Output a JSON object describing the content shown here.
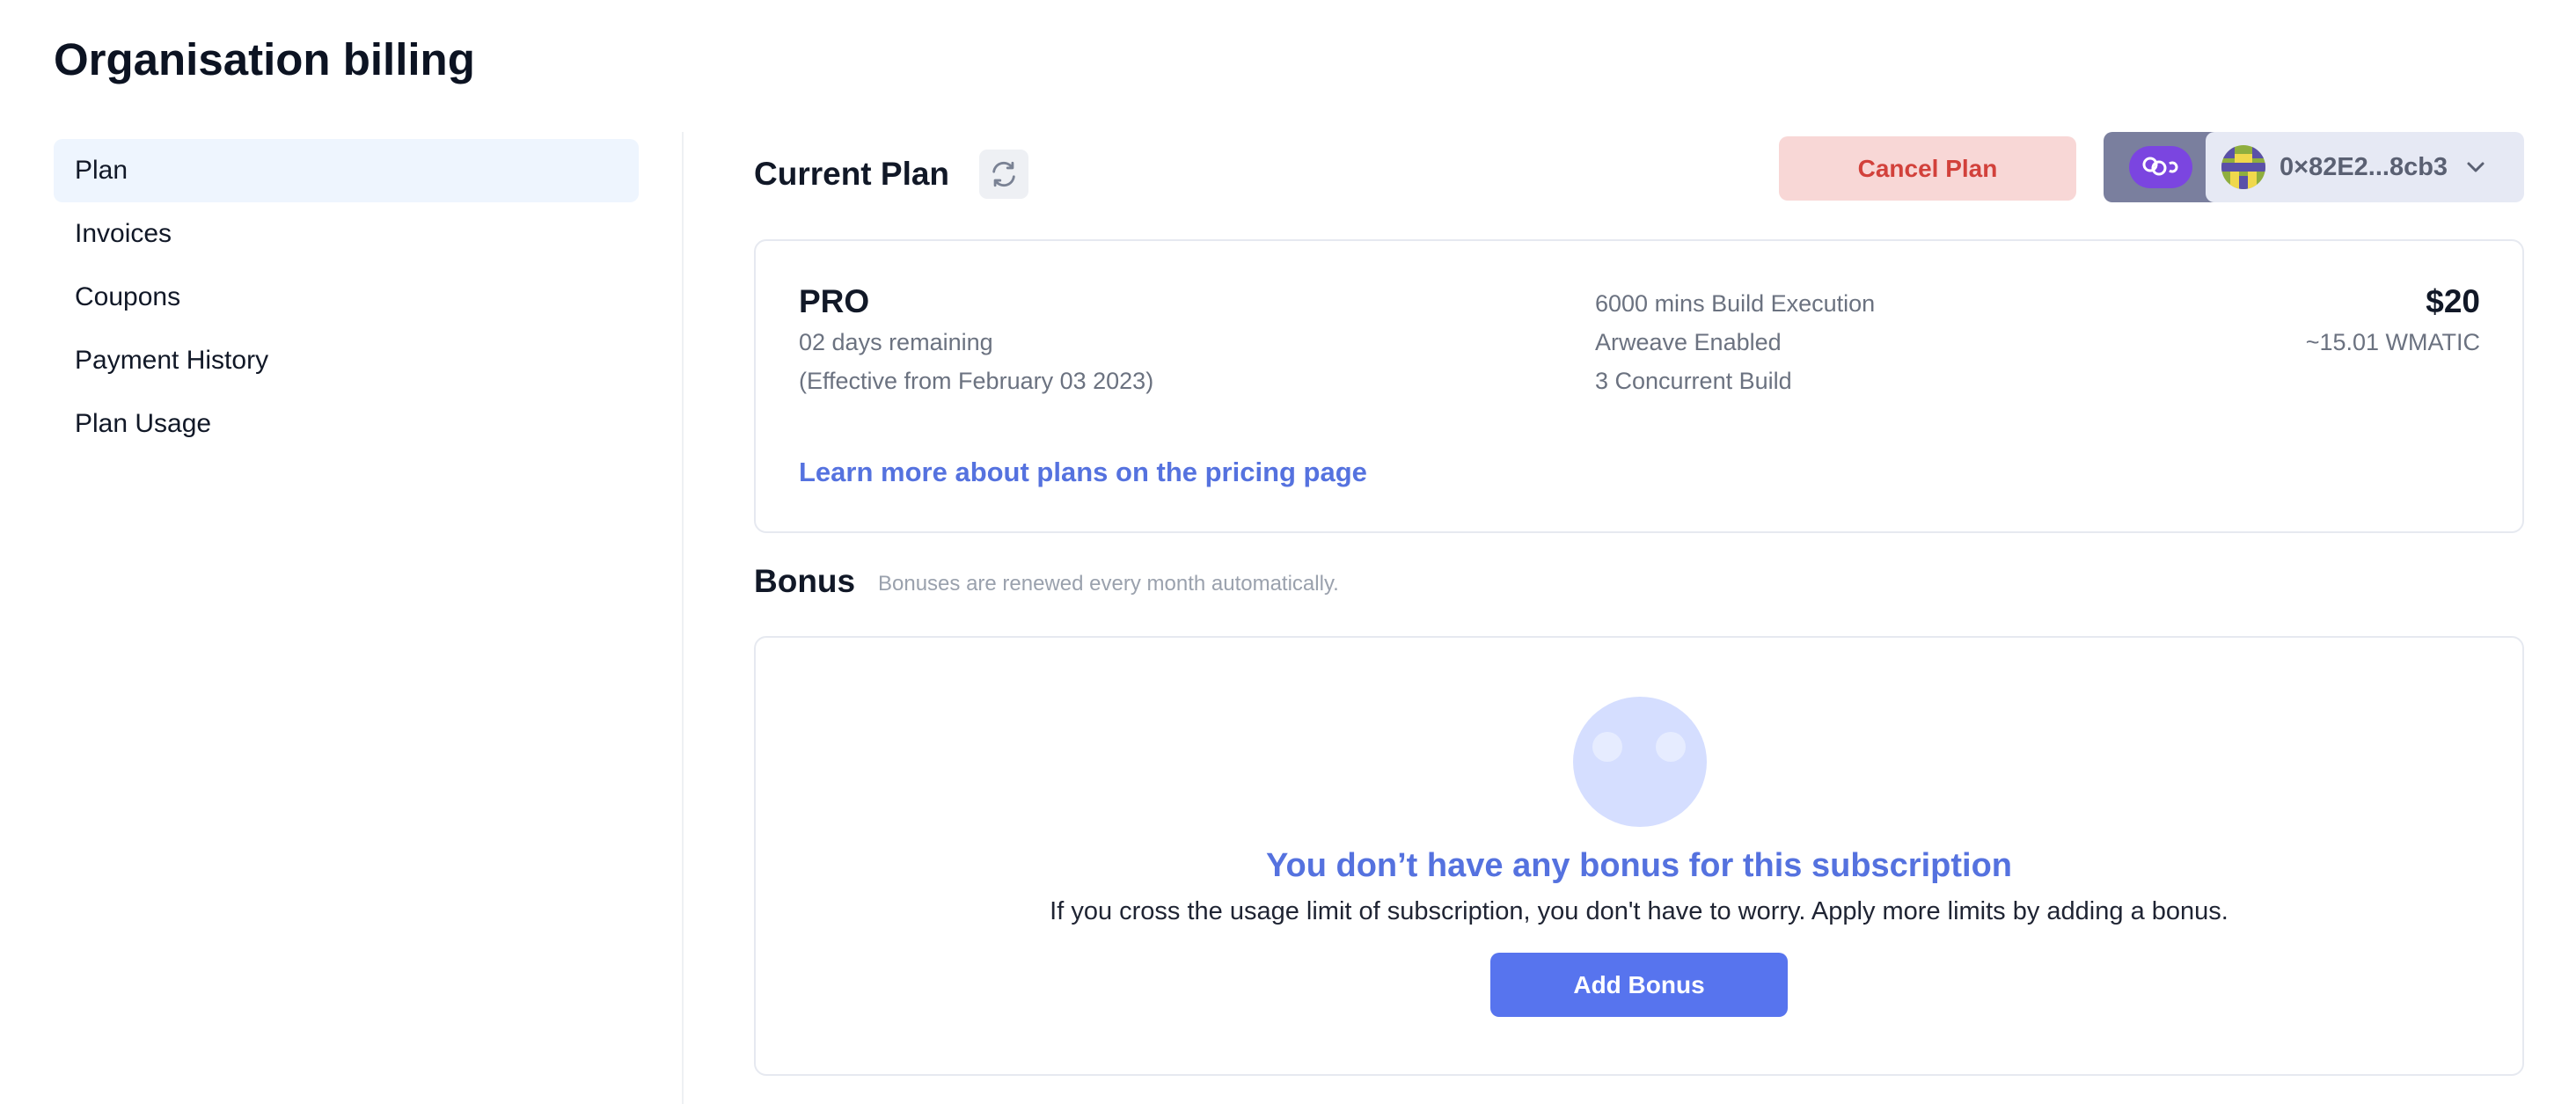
{
  "page": {
    "title": "Organisation billing"
  },
  "sidebar": {
    "items": [
      {
        "label": "Plan",
        "active": true
      },
      {
        "label": "Invoices"
      },
      {
        "label": "Coupons"
      },
      {
        "label": "Payment History"
      },
      {
        "label": "Plan Usage"
      }
    ]
  },
  "current_plan": {
    "title": "Current Plan",
    "refresh_icon": "refresh-icon",
    "cancel_label": "Cancel Plan",
    "wallet": {
      "chain_icon": "polygon-icon",
      "address": "0×82E2...8cb3",
      "dropdown_icon": "chevron-down-icon"
    },
    "plan": {
      "name": "PRO",
      "days_remaining": "02 days remaining",
      "effective": "(Effective from February 03 2023)",
      "features": [
        "6000 mins Build Execution",
        "Arweave Enabled",
        "3 Concurrent Build"
      ],
      "price": "$20",
      "price_token": "~15.01 WMATIC",
      "pricing_link": "Learn more about plans on the pricing page"
    }
  },
  "bonus": {
    "title": "Bonus",
    "note": "Bonuses are renewed every month automatically.",
    "empty_title": "You don’t have any bonus for this subscription",
    "empty_desc": "If you cross the usage limit of subscription, you don't have to worry. Apply more limits by adding a bonus.",
    "add_label": "Add Bonus"
  },
  "colors": {
    "accent": "#5774ee",
    "link": "#5572df",
    "danger_bg": "#f8d7d6",
    "danger_text": "#d2413b",
    "active_nav_bg": "#eef5fe"
  }
}
